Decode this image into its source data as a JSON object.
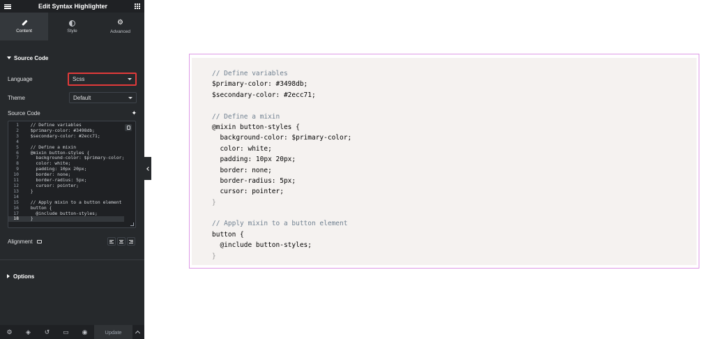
{
  "panel": {
    "title": "Edit Syntax Highlighter",
    "tabs": [
      {
        "label": "Content",
        "icon": "pencil-icon",
        "active": true
      },
      {
        "label": "Style",
        "icon": "half-circle-icon",
        "active": false
      },
      {
        "label": "Advanced",
        "icon": "gear-icon",
        "active": false
      }
    ],
    "source_section": {
      "title": "Source Code",
      "language_label": "Language",
      "language_value": "Scss",
      "theme_label": "Theme",
      "theme_value": "Default",
      "source_code_label": "Source Code",
      "alignment_label": "Alignment",
      "code_lines": [
        {
          "n": "1",
          "text": "  // Define variables"
        },
        {
          "n": "2",
          "text": "  $primary-color: #3498db;"
        },
        {
          "n": "3",
          "text": "  $secondary-color: #2ecc71;"
        },
        {
          "n": "4",
          "text": ""
        },
        {
          "n": "5",
          "text": "  // Define a mixin"
        },
        {
          "n": "6",
          "text": "  @mixin button-styles {"
        },
        {
          "n": "7",
          "text": "    background-color: $primary-color;"
        },
        {
          "n": "8",
          "text": "    color: white;"
        },
        {
          "n": "9",
          "text": "    padding: 10px 20px;"
        },
        {
          "n": "10",
          "text": "    border: none;"
        },
        {
          "n": "11",
          "text": "    border-radius: 5px;"
        },
        {
          "n": "12",
          "text": "    cursor: pointer;"
        },
        {
          "n": "13",
          "text": "  }"
        },
        {
          "n": "14",
          "text": ""
        },
        {
          "n": "15",
          "text": "  // Apply mixin to a button element"
        },
        {
          "n": "16",
          "text": "  button {"
        },
        {
          "n": "17",
          "text": "    @include button-styles;"
        },
        {
          "n": "18",
          "text": "  }"
        }
      ]
    },
    "options_section": {
      "title": "Options"
    },
    "bottom_bar": {
      "update_label": "Update"
    }
  },
  "preview": {
    "lines": [
      {
        "text": "// Define variables",
        "kind": "comment"
      },
      {
        "text": "$primary-color: #3498db;",
        "kind": "code"
      },
      {
        "text": "$secondary-color: #2ecc71;",
        "kind": "code"
      },
      {
        "text": "",
        "kind": "code"
      },
      {
        "text": "// Define a mixin",
        "kind": "comment"
      },
      {
        "text": "@mixin button-styles {",
        "kind": "code"
      },
      {
        "text": "  background-color: $primary-color;",
        "kind": "code"
      },
      {
        "text": "  color: white;",
        "kind": "code"
      },
      {
        "text": "  padding: 10px 20px;",
        "kind": "code"
      },
      {
        "text": "  border: none;",
        "kind": "code"
      },
      {
        "text": "  border-radius: 5px;",
        "kind": "code"
      },
      {
        "text": "  cursor: pointer;",
        "kind": "code"
      },
      {
        "text": "}",
        "kind": "punc"
      },
      {
        "text": "",
        "kind": "code"
      },
      {
        "text": "// Apply mixin to a button element",
        "kind": "comment"
      },
      {
        "text": "button {",
        "kind": "code"
      },
      {
        "text": "  @include button-styles;",
        "kind": "code"
      },
      {
        "text": "}",
        "kind": "punc"
      }
    ]
  },
  "colors": {
    "panel_bg": "#26292c",
    "accent_highlight": "#e23a3a",
    "preview_border": "#dd99e6",
    "code_bg": "#f5f2f0"
  }
}
